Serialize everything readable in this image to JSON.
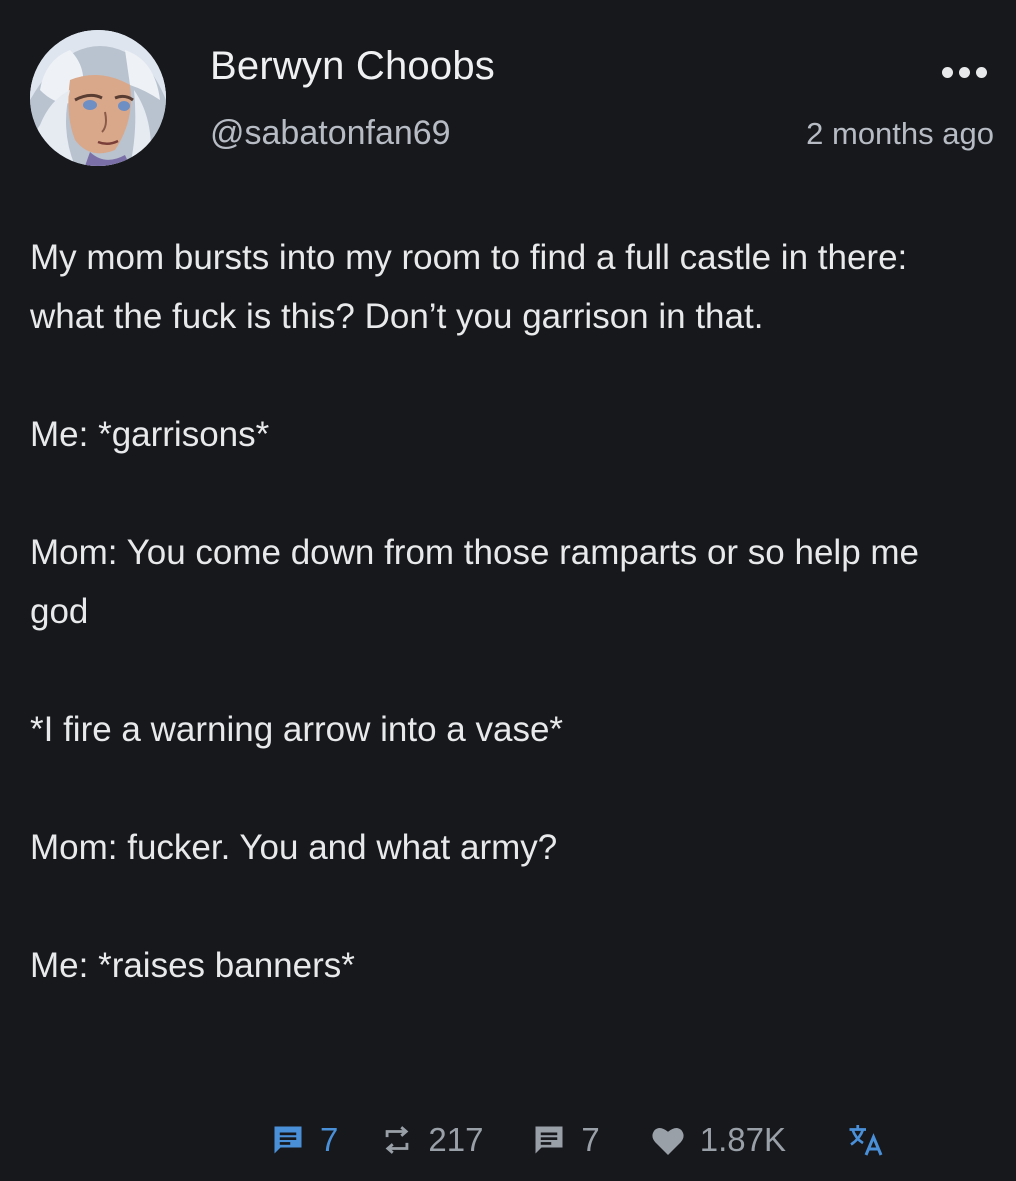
{
  "post": {
    "author": {
      "display_name": "Berwyn Choobs",
      "handle": "@sabatonfan69"
    },
    "timestamp": "2 months ago",
    "paragraphs": [
      "My mom bursts into my room to find a full castle in there: what the fuck is this? Don’t you garrison in that.",
      "Me: *garrisons*",
      "Mom: You come down from those ramparts or so help me god",
      "*I fire a warning arrow into a vase*",
      "Mom: fucker. You and what army?",
      "Me: *raises banners*"
    ],
    "actions": {
      "comments": {
        "icon": "comment-icon",
        "count": "7",
        "color": "#4a90d9"
      },
      "reblogs": {
        "icon": "repost-icon",
        "count": "217"
      },
      "replies": {
        "icon": "reply-icon",
        "count": "7"
      },
      "likes": {
        "icon": "heart-icon",
        "count": "1.87K"
      },
      "translate": {
        "icon": "translate-icon"
      }
    }
  },
  "colors": {
    "background": "#16181c",
    "text": "#e7e9ea",
    "muted": "#9aa0a8",
    "accent": "#4a90d9"
  }
}
